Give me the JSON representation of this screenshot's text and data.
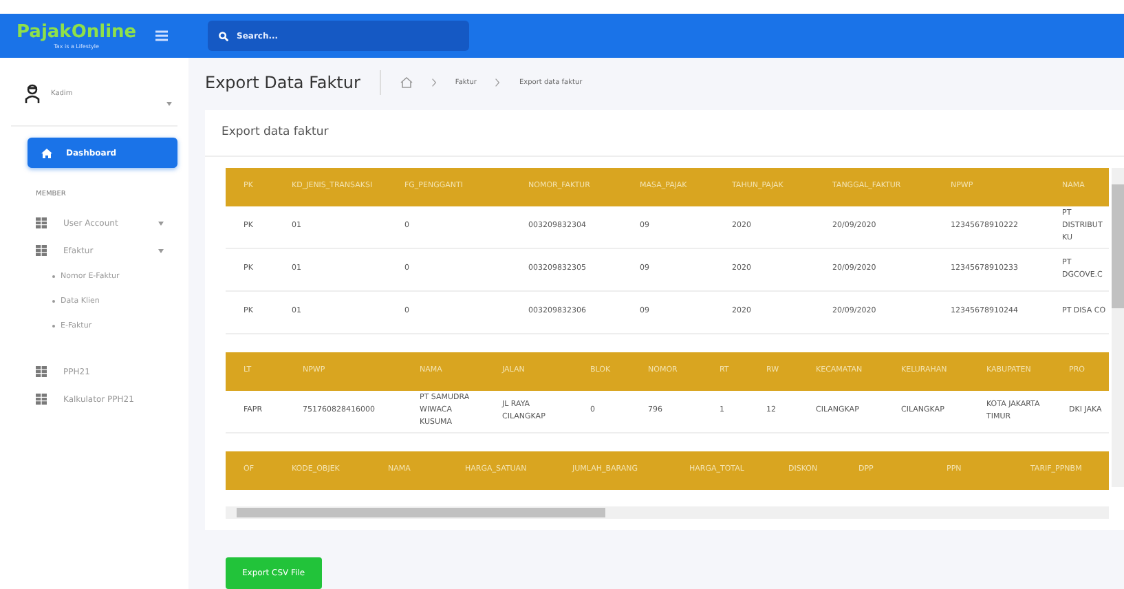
{
  "topbar": {
    "logo": "PajakOnline",
    "tagline": "Tax is a Lifestyle",
    "search": {
      "placeholder": "Search..."
    }
  },
  "user": {
    "name": "Kadim"
  },
  "sidebar": {
    "items": [
      {
        "kind": "link",
        "label": "Dashboard",
        "selected": true
      },
      {
        "kind": "section",
        "label": "MEMBER"
      },
      {
        "kind": "menu",
        "label": "User Account"
      },
      {
        "kind": "menu",
        "label": "Efaktur",
        "children": [
          {
            "label": "Nomor E-Faktur"
          },
          {
            "label": "Data Klien"
          },
          {
            "label": "E-Faktur"
          }
        ]
      },
      {
        "kind": "link",
        "label": "PPH21",
        "selected": false
      },
      {
        "kind": "link",
        "label": "Kalkulator PPH21",
        "selected": false
      }
    ]
  },
  "page": {
    "title": "Export Data Faktur",
    "breadcrumb": [
      "Faktur",
      "Export data faktur"
    ]
  },
  "card": {
    "title": "Export data faktur",
    "tables": [
      {
        "columns": [
          "PK",
          "KD_JENIS_TRANSAKSI",
          "FG_PENGGANTI",
          "NOMOR_FAKTUR",
          "MASA_PAJAK",
          "TAHUN_PAJAK",
          "TANGGAL_FAKTUR",
          "NPWP",
          "NAMA"
        ],
        "rows": [
          [
            "PK",
            "01",
            "0",
            "003209832304",
            "09",
            "2020",
            "20/09/2020",
            "12345678910222",
            "PT DISTRIBUT KU"
          ],
          [
            "PK",
            "01",
            "0",
            "003209832305",
            "09",
            "2020",
            "20/09/2020",
            "12345678910233",
            "PT DGCOVE.C"
          ],
          [
            "PK",
            "01",
            "0",
            "003209832306",
            "09",
            "2020",
            "20/09/2020",
            "12345678910244",
            "PT DISA CO"
          ]
        ]
      },
      {
        "columns": [
          "LT",
          "NPWP",
          "NAMA",
          "JALAN",
          "BLOK",
          "NOMOR",
          "RT",
          "RW",
          "KECAMATAN",
          "KELURAHAN",
          "KABUPATEN",
          "PRO"
        ],
        "rows": [
          [
            "FAPR",
            "751760828416000",
            "PT SAMUDRA WIWACA KUSUMA",
            "JL RAYA CILANGKAP",
            "0",
            "796",
            "1",
            "12",
            "CILANGKAP",
            "CILANGKAP",
            "KOTA JAKARTA TIMUR",
            "DKI JAKA"
          ]
        ]
      },
      {
        "columns": [
          "OF",
          "KODE_OBJEK",
          "NAMA",
          "HARGA_SATUAN",
          "JUMLAH_BARANG",
          "HARGA_TOTAL",
          "DISKON",
          "DPP",
          "PPN",
          "TARIF_PPNBM"
        ]
      }
    ]
  },
  "export_button": "Export CSV File"
}
